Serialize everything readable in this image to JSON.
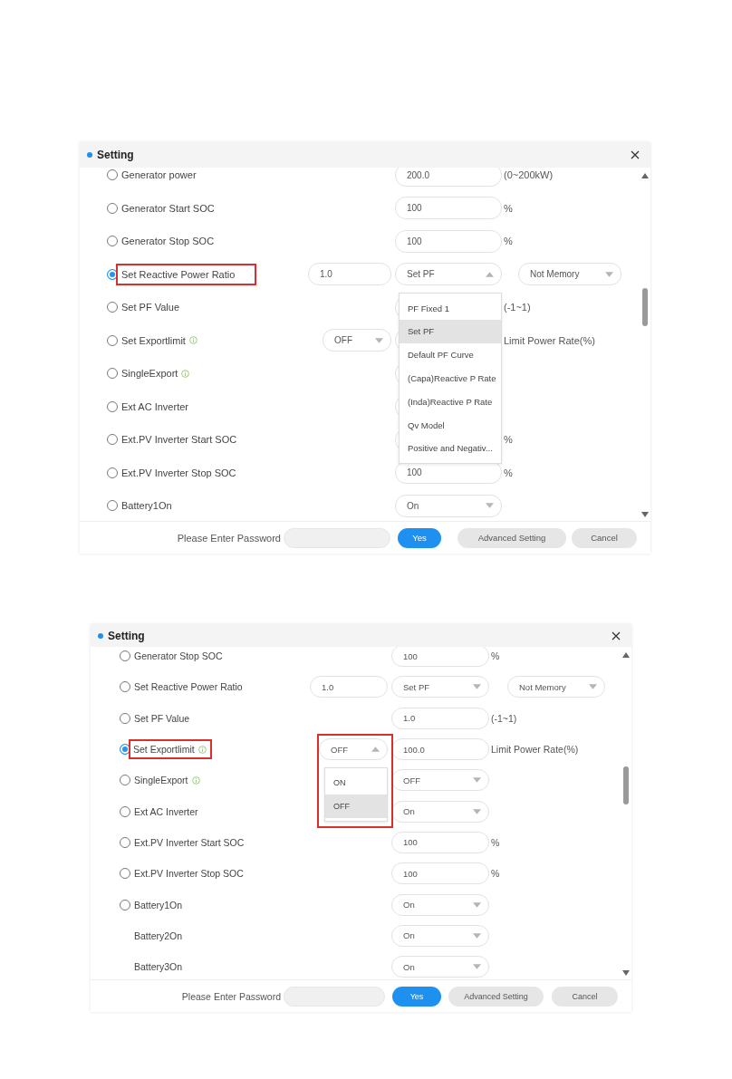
{
  "dialogs": [
    {
      "title": "Setting",
      "rows": [
        {
          "kind": "option",
          "label": "Generator power",
          "selected": false,
          "highlighted": false,
          "main_control": {
            "kind": "input",
            "value": "200.0"
          },
          "unit": "(0~200kW)"
        },
        {
          "kind": "option",
          "label": "Generator Start SOC",
          "selected": false,
          "highlighted": false,
          "main_control": {
            "kind": "input",
            "value": "100"
          },
          "unit": "%"
        },
        {
          "kind": "option",
          "label": "Generator Stop SOC",
          "selected": false,
          "highlighted": false,
          "main_control": {
            "kind": "input",
            "value": "100"
          },
          "unit": "%"
        },
        {
          "kind": "option",
          "label": "Set Reactive Power Ratio",
          "selected": true,
          "highlighted": true,
          "left_control": {
            "kind": "input",
            "value": "1.0"
          },
          "main_control": {
            "kind": "select",
            "value": "Set PF",
            "open": true,
            "highlighted": false,
            "options": [
              {
                "label": "PF Fixed 1",
                "selected": false
              },
              {
                "label": "Set PF",
                "selected": true
              },
              {
                "label": "Default PF Curve",
                "selected": false
              },
              {
                "label": "(Capa)Reactive P Rate",
                "selected": false
              },
              {
                "label": "(Inda)Reactive P Rate",
                "selected": false
              },
              {
                "label": "Qv Model",
                "selected": false
              },
              {
                "label": "Positive and Negativ...",
                "selected": false
              }
            ]
          },
          "right_control": {
            "kind": "select",
            "value": "Not Memory"
          }
        },
        {
          "kind": "option",
          "label": "Set PF Value",
          "selected": false,
          "highlighted": false,
          "main_control": {
            "kind": "input"
          },
          "unit": "(-1~1)"
        },
        {
          "kind": "option",
          "label": "Set Exportlimit",
          "info": true,
          "selected": false,
          "highlighted": false,
          "left_control": {
            "kind": "select",
            "value": "OFF"
          },
          "main_control": {
            "kind": "input"
          },
          "unit": "Limit Power Rate(%)"
        },
        {
          "kind": "option",
          "label": "SingleExport",
          "info": true,
          "selected": false,
          "highlighted": false,
          "main_control": {
            "kind": "input"
          }
        },
        {
          "kind": "option",
          "label": "Ext AC Inverter",
          "selected": false,
          "highlighted": false,
          "main_control": {
            "kind": "input"
          }
        },
        {
          "kind": "option",
          "label": "Ext.PV Inverter Start SOC",
          "selected": false,
          "highlighted": false,
          "main_control": {
            "kind": "input"
          },
          "unit": "%"
        },
        {
          "kind": "option",
          "label": "Ext.PV Inverter Stop SOC",
          "selected": false,
          "highlighted": false,
          "main_control": {
            "kind": "input",
            "value": "100"
          },
          "unit": "%"
        },
        {
          "kind": "option",
          "label": "Battery1On",
          "selected": false,
          "highlighted": false,
          "main_control": {
            "kind": "select",
            "value": "On"
          }
        }
      ],
      "footer": {
        "password_label": "Please Enter Password",
        "buttons": [
          {
            "label": "Yes",
            "kind": "primary"
          },
          {
            "label": "Advanced Setting",
            "kind": "secondary"
          },
          {
            "label": "Cancel",
            "kind": "secondary"
          }
        ]
      }
    },
    {
      "title": "Setting",
      "rows": [
        {
          "kind": "option",
          "label": "Generator Stop SOC",
          "selected": false,
          "highlighted": false,
          "main_control": {
            "kind": "input",
            "value": "100"
          },
          "unit": "%"
        },
        {
          "kind": "option",
          "label": "Set Reactive Power Ratio",
          "selected": false,
          "highlighted": false,
          "left_control": {
            "kind": "input",
            "value": "1.0"
          },
          "main_control": {
            "kind": "select",
            "value": "Set PF"
          },
          "right_control": {
            "kind": "select",
            "value": "Not Memory"
          }
        },
        {
          "kind": "option",
          "label": "Set PF Value",
          "selected": false,
          "highlighted": false,
          "main_control": {
            "kind": "input",
            "value": "1.0"
          },
          "unit": "(-1~1)"
        },
        {
          "kind": "option",
          "label": "Set Exportlimit",
          "info": true,
          "selected": true,
          "highlighted": true,
          "left_control": {
            "kind": "select",
            "value": "OFF",
            "open": true,
            "highlighted": true,
            "options": [
              {
                "label": "ON",
                "selected": false
              },
              {
                "label": "OFF",
                "selected": true
              }
            ]
          },
          "main_control": {
            "kind": "input",
            "value": "100.0"
          },
          "unit": "Limit Power Rate(%)"
        },
        {
          "kind": "option",
          "label": "SingleExport",
          "info": true,
          "selected": false,
          "highlighted": false,
          "main_control": {
            "kind": "select",
            "value": "OFF"
          }
        },
        {
          "kind": "option",
          "label": "Ext AC Inverter",
          "selected": false,
          "highlighted": false,
          "main_control": {
            "kind": "select",
            "value": "On"
          }
        },
        {
          "kind": "option",
          "label": "Ext.PV Inverter Start SOC",
          "selected": false,
          "highlighted": false,
          "main_control": {
            "kind": "input",
            "value": "100"
          },
          "unit": "%"
        },
        {
          "kind": "option",
          "label": "Ext.PV Inverter Stop SOC",
          "selected": false,
          "highlighted": false,
          "main_control": {
            "kind": "input",
            "value": "100"
          },
          "unit": "%"
        },
        {
          "kind": "option",
          "label": "Battery1On",
          "selected": false,
          "highlighted": false,
          "main_control": {
            "kind": "select",
            "value": "On"
          }
        },
        {
          "kind": "plain",
          "label": "Battery2On",
          "highlighted": false,
          "main_control": {
            "kind": "select",
            "value": "On"
          }
        },
        {
          "kind": "plain",
          "label": "Battery3On",
          "highlighted": false,
          "main_control": {
            "kind": "select",
            "value": "On"
          }
        }
      ],
      "footer": {
        "password_label": "Please Enter Password",
        "buttons": [
          {
            "label": "Yes",
            "kind": "primary"
          },
          {
            "label": "Advanced Setting",
            "kind": "secondary"
          },
          {
            "label": "Cancel",
            "kind": "secondary"
          }
        ]
      }
    }
  ]
}
